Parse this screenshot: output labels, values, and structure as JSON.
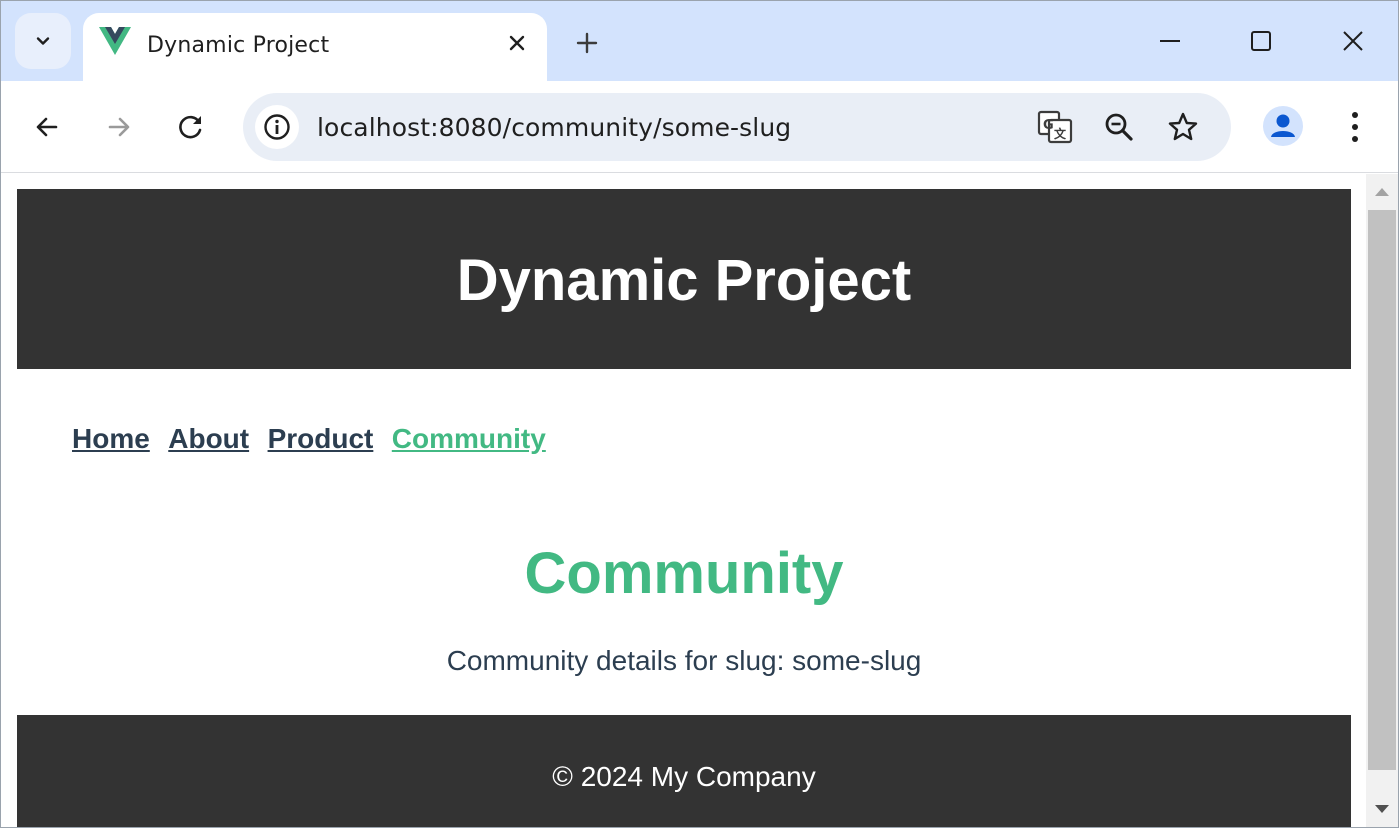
{
  "browser": {
    "tab": {
      "title": "Dynamic Project",
      "favicon": "vue-logo-icon"
    },
    "address_bar": {
      "url": "localhost:8080/community/some-slug"
    },
    "icons": {
      "tab_search": "chevron-down-icon",
      "tab_close": "close-icon",
      "new_tab": "plus-icon",
      "minimize": "minimize-icon",
      "maximize": "maximize-icon",
      "close_window": "close-icon",
      "back": "back-arrow-icon",
      "forward": "forward-arrow-icon",
      "reload": "reload-icon",
      "site_info": "info-icon",
      "translate": "translate-icon",
      "zoom": "zoom-out-icon",
      "bookmark": "star-icon",
      "profile": "profile-icon",
      "menu": "kebab-menu-icon"
    }
  },
  "page": {
    "header": {
      "title": "Dynamic Project"
    },
    "nav": {
      "links": [
        {
          "label": "Home",
          "active": false
        },
        {
          "label": "About",
          "active": false
        },
        {
          "label": "Product",
          "active": false
        },
        {
          "label": "Community",
          "active": true
        }
      ]
    },
    "main": {
      "heading": "Community",
      "description": "Community details for slug: some-slug"
    },
    "footer": {
      "text": "© 2024 My Company"
    }
  },
  "colors": {
    "tabstrip": "#d3e3fd",
    "omnibox": "#e9eef6",
    "header_bg": "#333333",
    "accent_green": "#42b983",
    "nav_text": "#2c3e50",
    "text_dark": "#2c3e50"
  }
}
